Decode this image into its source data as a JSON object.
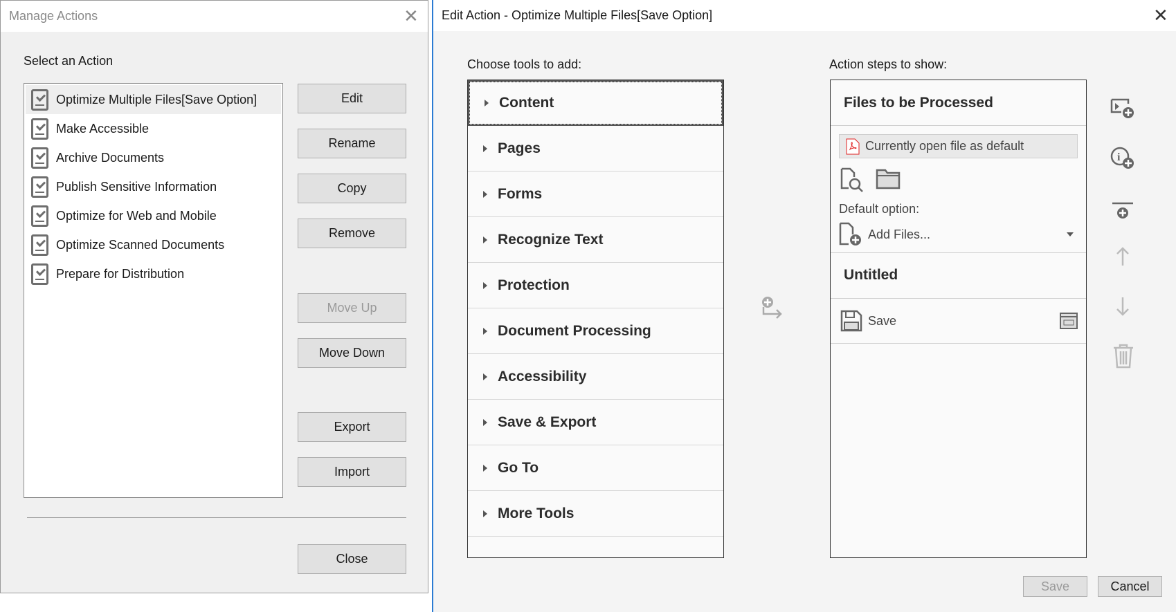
{
  "manage": {
    "title": "Manage Actions",
    "select_label": "Select an Action",
    "actions": [
      "Optimize Multiple Files[Save Option]",
      "Make Accessible",
      "Archive Documents",
      "Publish Sensitive Information",
      "Optimize for Web and Mobile",
      "Optimize Scanned Documents",
      "Prepare for Distribution"
    ],
    "buttons": {
      "edit": "Edit",
      "rename": "Rename",
      "copy": "Copy",
      "remove": "Remove",
      "move_up": "Move Up",
      "move_down": "Move Down",
      "export": "Export",
      "import": "Import",
      "close": "Close"
    }
  },
  "edit": {
    "title": "Edit Action - Optimize Multiple Files[Save Option]",
    "tools_label": "Choose tools to add:",
    "tools": [
      "Content",
      "Pages",
      "Forms",
      "Recognize Text",
      "Protection",
      "Document Processing",
      "Accessibility",
      "Save & Export",
      "Go To",
      "More Tools"
    ],
    "steps_label": "Action steps to show:",
    "steps": {
      "files_header": "Files to be Processed",
      "current_file": "Currently open file as default",
      "default_option_label": "Default option:",
      "default_option_value": "Add Files...",
      "group_header": "Untitled",
      "step_save": "Save"
    },
    "buttons": {
      "save": "Save",
      "cancel": "Cancel"
    }
  }
}
